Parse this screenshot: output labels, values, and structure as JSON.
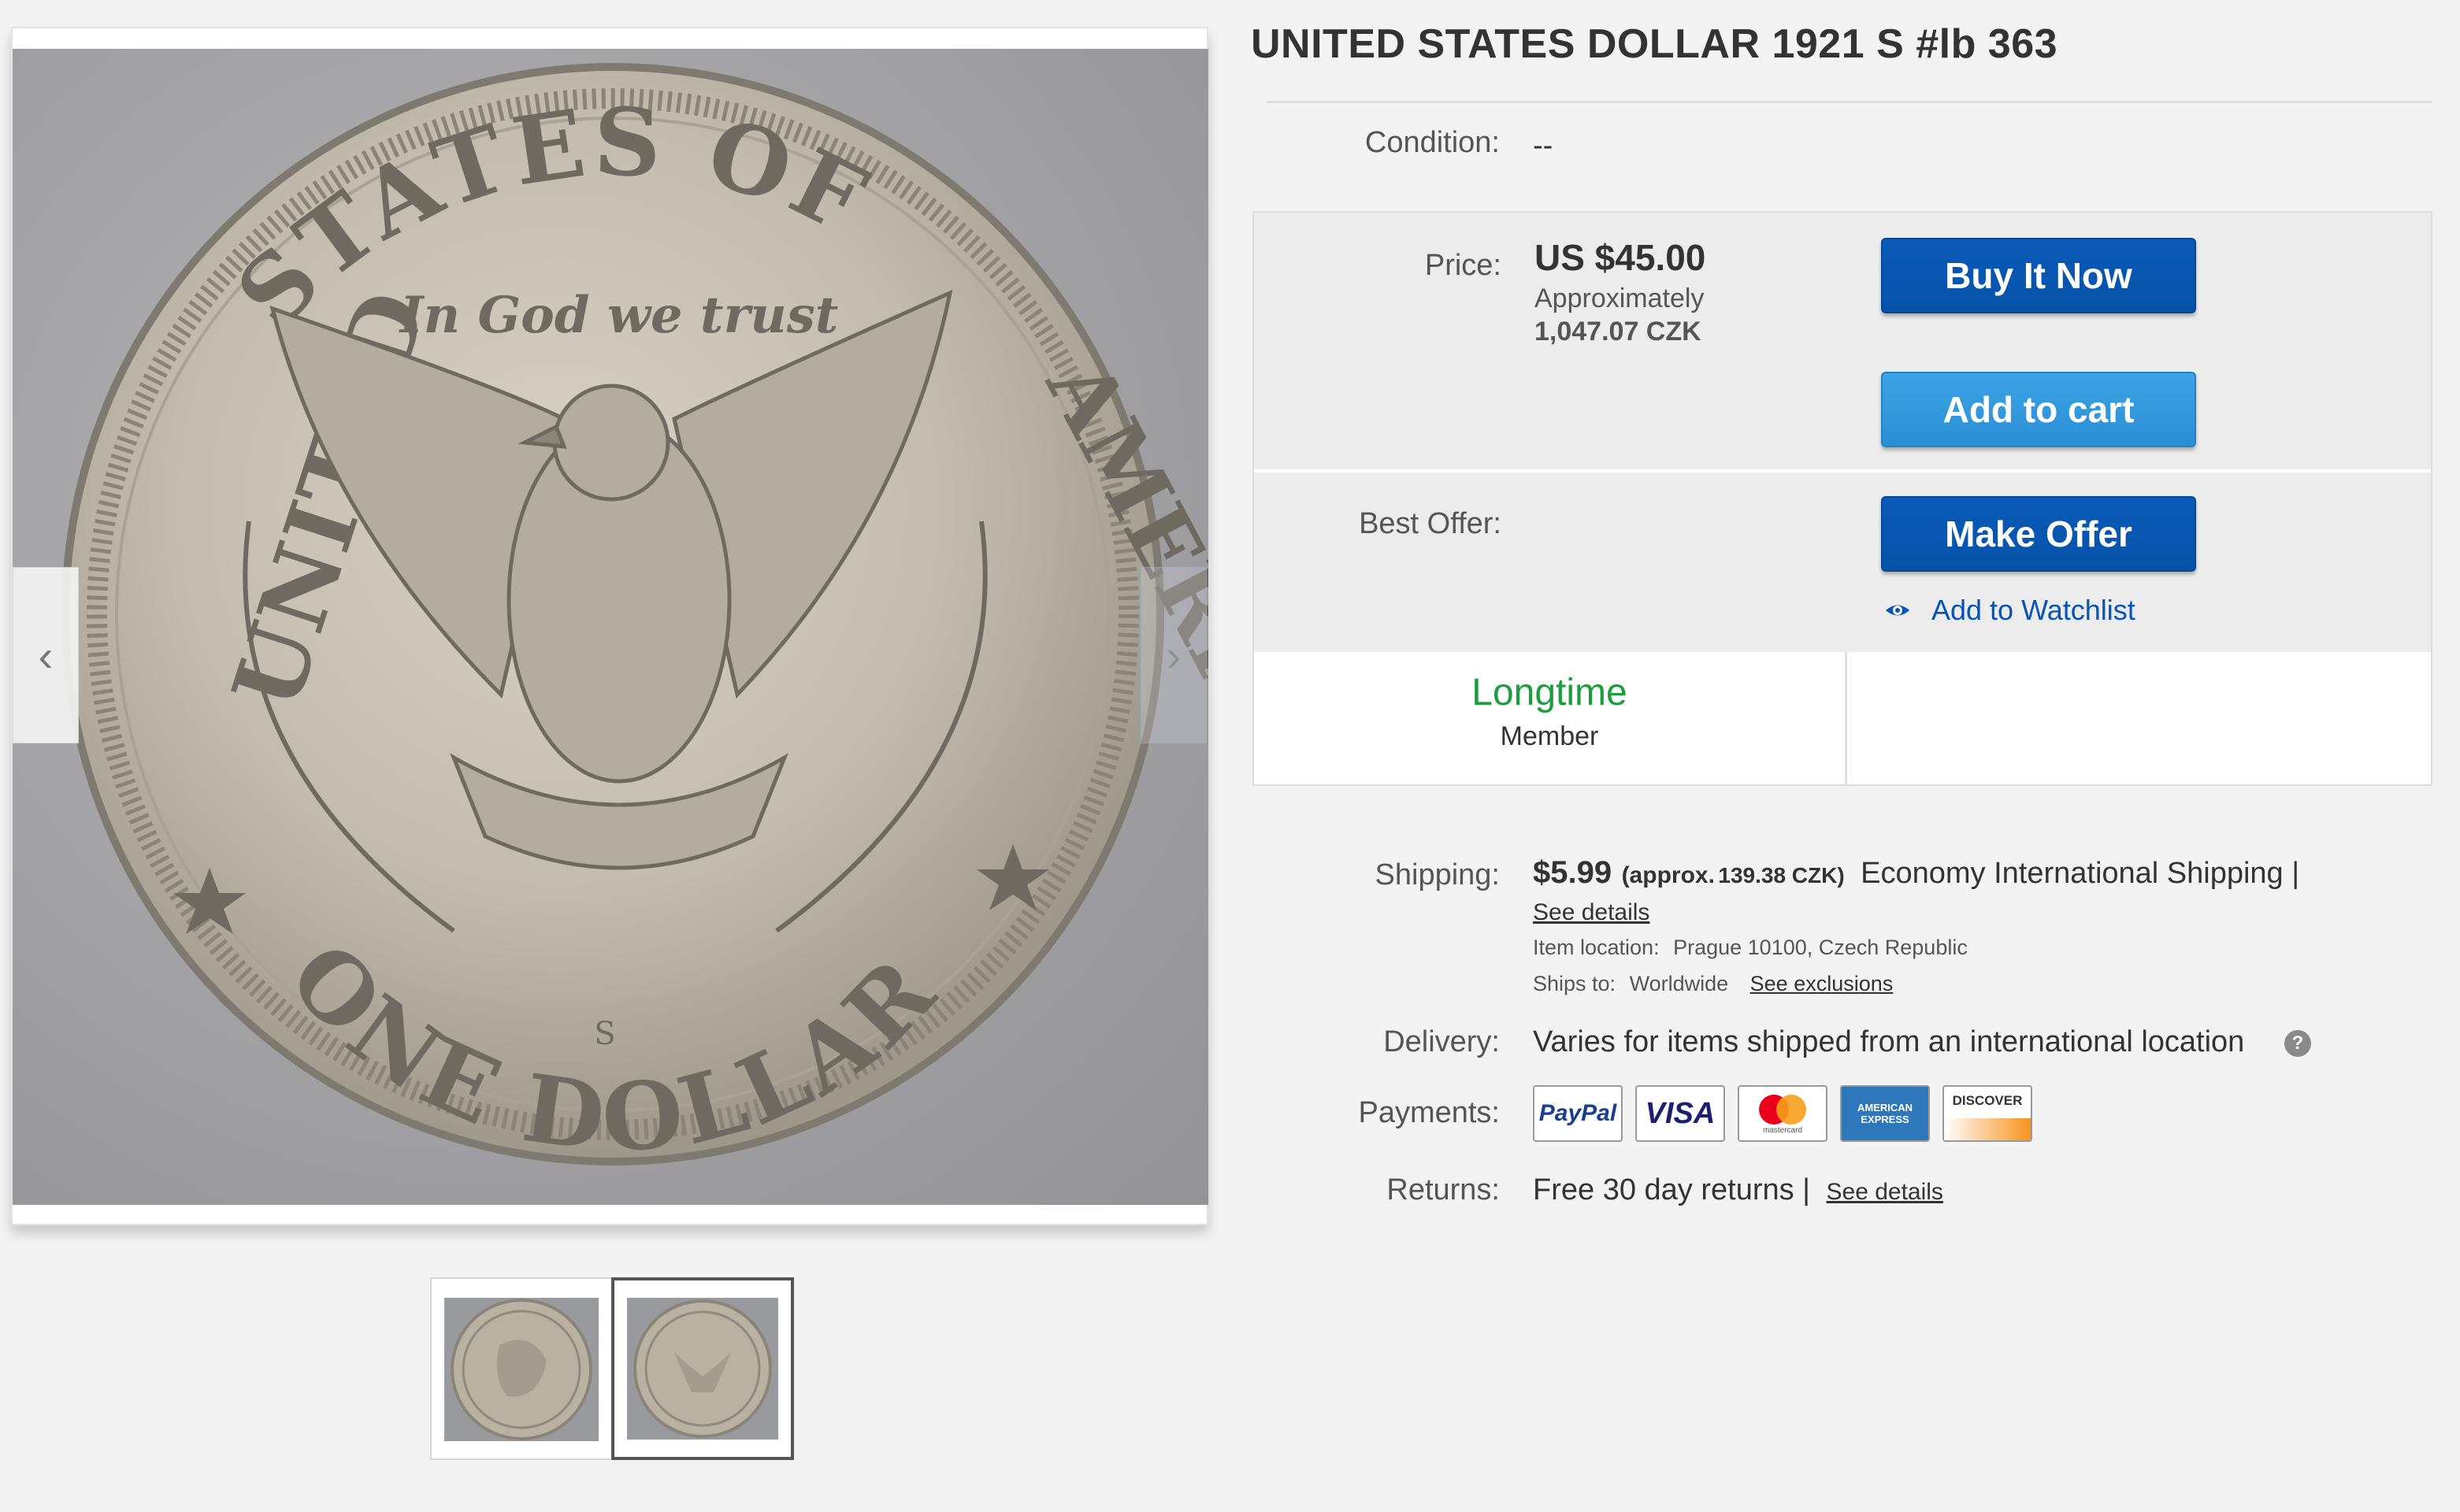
{
  "listing": {
    "title": "UNITED STATES DOLLAR 1921 S #lb 363",
    "condition_label": "Condition:",
    "condition_value": "--"
  },
  "gallery": {
    "coin_legend_top": "STATES OF",
    "coin_legend_left": "UNITED",
    "coin_legend_right": "AMERICA",
    "coin_motto": "In God we trust",
    "coin_denomination": "ONE DOLLAR",
    "coin_mint_mark": "S",
    "prev_arrow": "‹",
    "next_arrow": "›"
  },
  "price": {
    "label": "Price:",
    "amount": "US $45.00",
    "approx_label": "Approximately",
    "approx_value": "1,047.07 CZK"
  },
  "buttons": {
    "buy_now": "Buy It Now",
    "add_to_cart": "Add to cart",
    "make_offer": "Make Offer",
    "watchlist": "Add to Watchlist"
  },
  "best_offer": {
    "label": "Best Offer:"
  },
  "member": {
    "line1": "Longtime",
    "line2": "Member"
  },
  "shipping": {
    "label": "Shipping:",
    "cost": "$5.99",
    "approx": "(approx.",
    "approx_value": "139.38 CZK)",
    "method": "Economy International Shipping |",
    "see_details": "See details",
    "location_label": "Item location:",
    "location_value": "Prague 10100, Czech Republic",
    "ships_label": "Ships to:",
    "ships_value": "Worldwide",
    "see_exclusions": "See exclusions"
  },
  "delivery": {
    "label": "Delivery:",
    "value": "Varies for items shipped from an international location",
    "help_icon": "?"
  },
  "payments": {
    "label": "Payments:",
    "logos": [
      "PayPal",
      "VISA",
      "mastercard",
      "AMERICAN EXPRESS",
      "DISCOVER"
    ]
  },
  "returns": {
    "label": "Returns:",
    "value": "Free 30 day returns |",
    "see_details": "See details"
  },
  "colors": {
    "buy_now": "#0654ba",
    "add_to_cart": "#3498dc",
    "member_green": "#1b9e3e",
    "link_blue": "#0654ba"
  }
}
